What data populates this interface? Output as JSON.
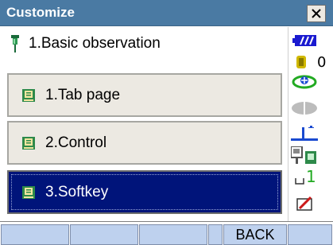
{
  "window": {
    "title": "Customize",
    "close_glyph": "×"
  },
  "header": {
    "text": "1.Basic observation",
    "icon": "survey-pin-icon"
  },
  "menu": {
    "items": [
      {
        "label": "1.Tab page",
        "icon": "book-icon",
        "selected": false
      },
      {
        "label": "2.Control",
        "icon": "book-icon",
        "selected": false
      },
      {
        "label": "3.Softkey",
        "icon": "book-icon",
        "selected": true
      }
    ]
  },
  "status": {
    "battery_icon": "battery-icon",
    "memory_icon": "memory-icon",
    "memory_value": "0",
    "target_icon": "target-icon",
    "prism_icon": "prism-icon",
    "tilt_icon": "tilt-icon",
    "device_icon": "device-icon",
    "mode_icon": "input-mode-icon",
    "mode_value": "1",
    "edit_icon": "edit-disabled-icon"
  },
  "softkeys": {
    "keys": [
      "",
      "",
      "",
      "",
      "BACK",
      ""
    ]
  },
  "colors": {
    "titlebar": "#4a7aa3",
    "selection": "#00147a",
    "item_bg": "#ece9e2",
    "softkey_bg": "#bed1ee"
  }
}
